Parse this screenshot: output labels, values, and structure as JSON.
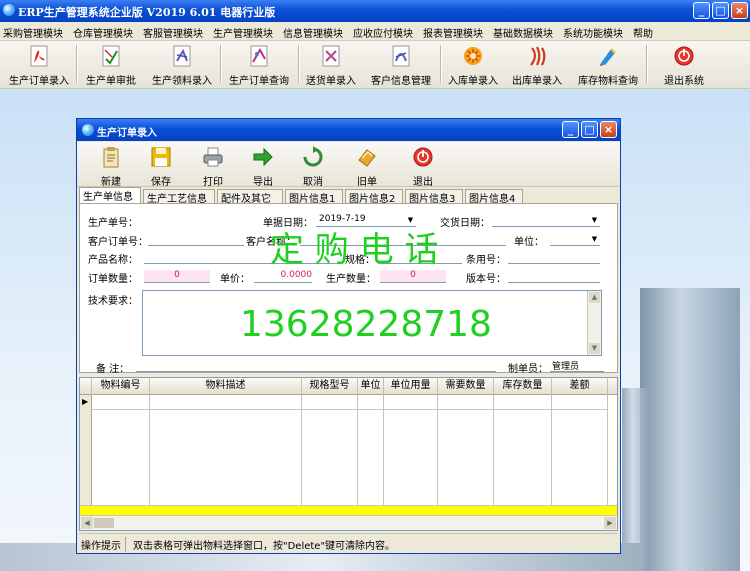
{
  "app": {
    "title": "ERP生产管理系统企业版    V2019 6.01 电器行业版",
    "window_buttons": [
      "_",
      "□",
      "×"
    ]
  },
  "menu": [
    "采购管理模块",
    "仓库管理模块",
    "客服管理模块",
    "生产管理模块",
    "信息管理模块",
    "应收应付模块",
    "报表管理模块",
    "基础数据模块",
    "系统功能模块",
    "帮助"
  ],
  "toolbar": [
    {
      "label": "生产订单录入",
      "icon": "pdf-document-icon"
    },
    {
      "label": "生产单审批",
      "icon": "approval-document-icon"
    },
    {
      "label": "生产领料录入",
      "icon": "material-document-icon"
    },
    {
      "label": "生产订单查询",
      "icon": "query-document-icon"
    },
    {
      "label": "送货单录入",
      "icon": "delivery-document-icon"
    },
    {
      "label": "客户信息管理",
      "icon": "customer-document-icon"
    },
    {
      "label": "入库单录入",
      "icon": "storage-in-icon"
    },
    {
      "label": "出库单录入",
      "icon": "storage-out-icon"
    },
    {
      "label": "库存物料查询",
      "icon": "inventory-query-icon"
    },
    {
      "label": "退出系统",
      "icon": "exit-icon"
    }
  ],
  "child": {
    "title": "生产订单录入",
    "toolbar": [
      {
        "label": "新建",
        "icon": "new-document-icon"
      },
      {
        "label": "保存",
        "icon": "save-floppy-icon"
      },
      {
        "label": "打印",
        "icon": "printer-icon"
      },
      {
        "label": "导出",
        "icon": "export-arrow-icon"
      },
      {
        "label": "取消",
        "icon": "cancel-refresh-icon"
      },
      {
        "label": "旧单",
        "icon": "old-order-icon"
      },
      {
        "label": "退出",
        "icon": "exit-icon"
      }
    ],
    "tabs": [
      "生产单信息",
      "生产工艺信息",
      "配件及其它",
      "图片信息1",
      "图片信息2",
      "图片信息3",
      "图片信息4"
    ],
    "form": {
      "order_no_label": "生产单号：",
      "order_date_label": "单据日期：",
      "order_date_value": "2019-7-19",
      "delivery_date_label": "交货日期：",
      "customer_order_label": "客户订单号：",
      "customer_name_label": "客户名称：",
      "unit_label": "单位：",
      "product_name_label": "产品名称：",
      "spec_label": "规格：",
      "usage_label": "条用号：",
      "order_qty_label": "订单数量：",
      "order_qty_value": "0",
      "unit_price_label": "单价：",
      "unit_price_value": "0.0000",
      "production_qty_label": "生产数量：",
      "production_qty_value": "0",
      "version_label": "版本号：",
      "tech_req_label": "技术要求：",
      "remark_label": "备  注：",
      "maker_label": "制单员：",
      "maker_value": "管理员"
    },
    "watermark_text": "定  购  电  话",
    "watermark_phone": "13628228718",
    "grid_columns": [
      "物料编号",
      "物料描述",
      "规格型号",
      "单位",
      "单位用量",
      "需要数量",
      "库存数量",
      "差额"
    ],
    "status_label": "操作提示",
    "status_text": "双击表格可弹出物料选择窗口，按\"Delete\"键可清除内容。"
  }
}
